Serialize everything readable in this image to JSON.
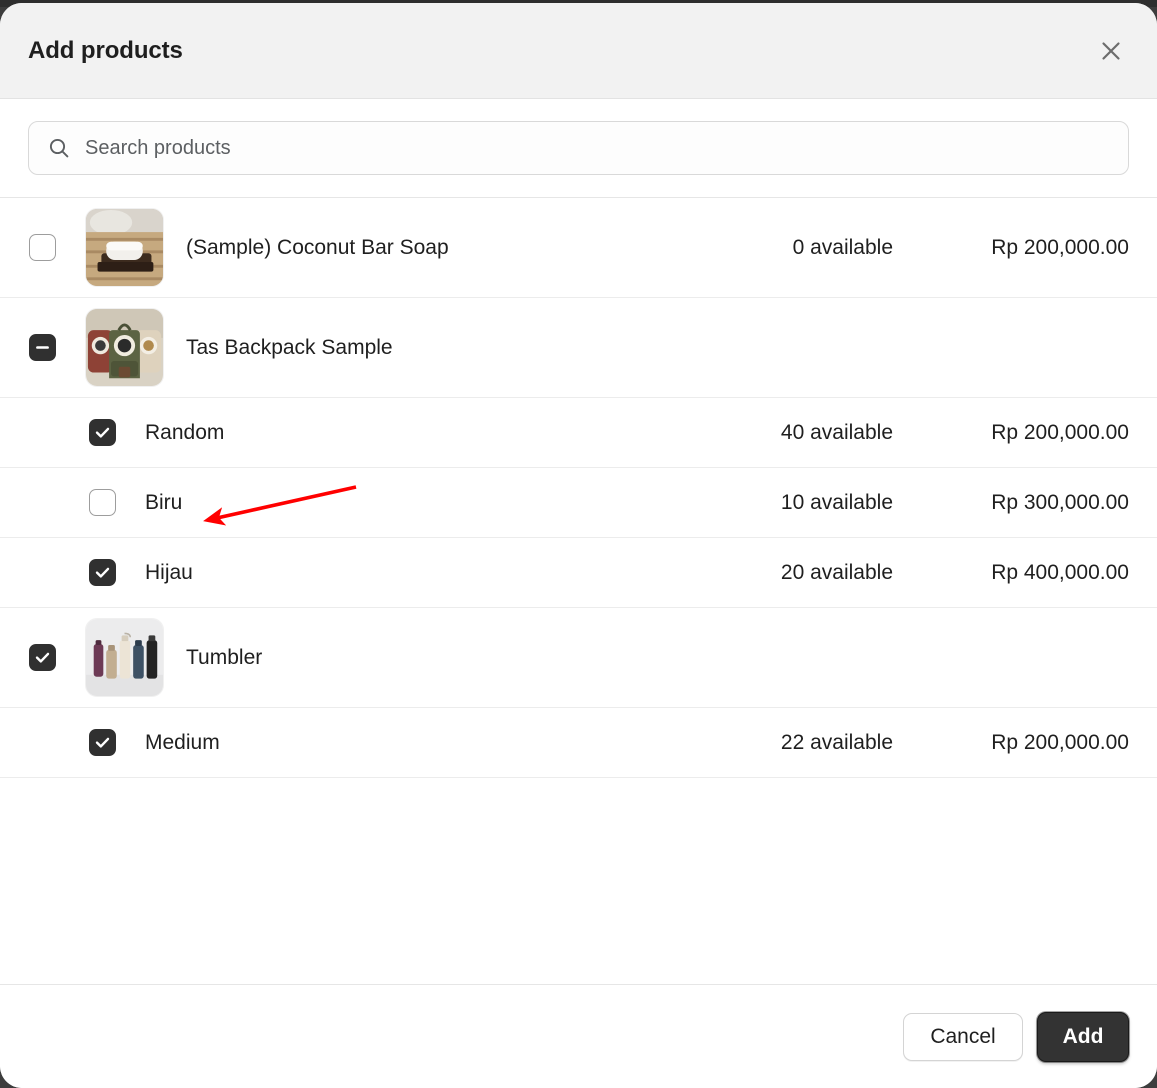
{
  "modal": {
    "title": "Add products",
    "close_icon": "close-icon"
  },
  "search": {
    "icon": "search-icon",
    "placeholder": "Search products",
    "value": ""
  },
  "rows": [
    {
      "type": "product",
      "name": "(Sample) Coconut Bar Soap",
      "checkbox_state": "unchecked",
      "thumbnail": "coconut-bar-soap-thumbnail",
      "available": "0 available",
      "price": "Rp 200,000.00"
    },
    {
      "type": "product",
      "name": "Tas Backpack Sample",
      "checkbox_state": "indeterminate",
      "thumbnail": "tas-backpack-thumbnail",
      "available": "",
      "price": ""
    },
    {
      "type": "variant",
      "name": "Random",
      "checkbox_state": "checked",
      "available": "40 available",
      "price": "Rp 200,000.00"
    },
    {
      "type": "variant",
      "name": "Biru",
      "checkbox_state": "unchecked",
      "available": "10 available",
      "price": "Rp 300,000.00"
    },
    {
      "type": "variant",
      "name": "Hijau",
      "checkbox_state": "checked",
      "available": "20 available",
      "price": "Rp 400,000.00"
    },
    {
      "type": "product",
      "name": "Tumbler",
      "checkbox_state": "checked",
      "thumbnail": "tumbler-thumbnail",
      "available": "",
      "price": ""
    },
    {
      "type": "variant",
      "name": "Medium",
      "checkbox_state": "checked",
      "available": "22 available",
      "price": "Rp 200,000.00"
    }
  ],
  "footer": {
    "cancel_label": "Cancel",
    "add_label": "Add"
  },
  "annotation": {
    "type": "arrow",
    "color": "#ff0000",
    "points_to": "Biru"
  },
  "colors": {
    "header_bg": "#f2f2f2",
    "checkbox_checked": "#303030",
    "primary_button": "#333333",
    "text": "#1f1f1f",
    "annotation": "#ff0000"
  }
}
